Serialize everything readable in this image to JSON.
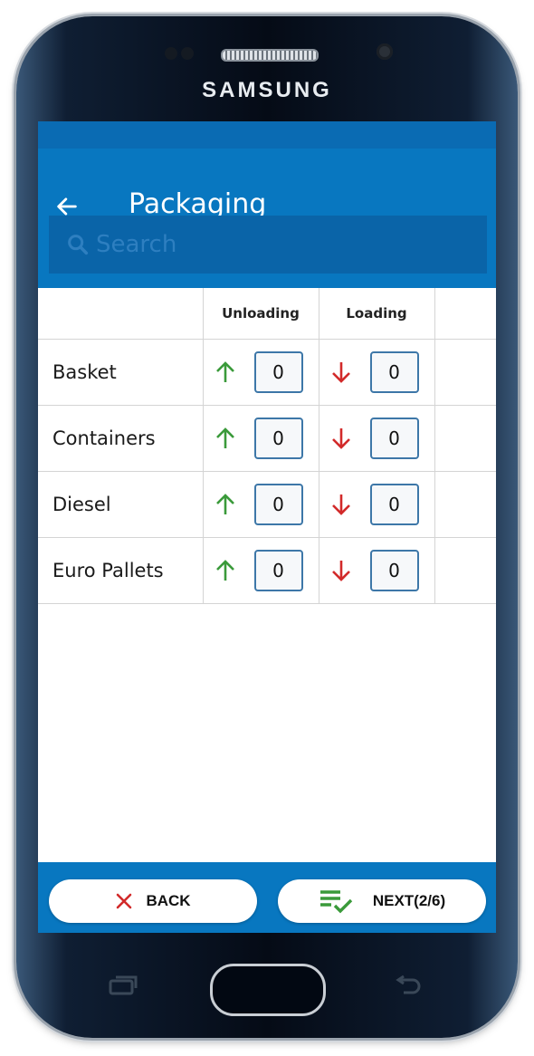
{
  "device": {
    "brand": "SAMSUNG"
  },
  "appbar": {
    "title": "Packaging",
    "back_icon": "arrow-left-icon"
  },
  "search": {
    "placeholder": "Search",
    "value": "",
    "icon": "search-icon"
  },
  "table": {
    "headers": [
      "",
      "Unloading",
      "Loading",
      ""
    ],
    "rows": [
      {
        "name": "Basket",
        "unloading": "0",
        "loading": "0"
      },
      {
        "name": "Containers",
        "unloading": "0",
        "loading": "0"
      },
      {
        "name": "Diesel",
        "unloading": "0",
        "loading": "0"
      },
      {
        "name": "Euro Pallets",
        "unloading": "0",
        "loading": "0"
      }
    ],
    "unloading_icon": "arrow-up-icon",
    "loading_icon": "arrow-down-icon"
  },
  "footer": {
    "back_label": "BACK",
    "next_label": "NEXT(2/6)"
  },
  "colors": {
    "primary": "#0877c0",
    "unloading_arrow": "#3a9a3a",
    "loading_arrow": "#d22a2a",
    "back_x": "#d22a2a",
    "next_icon": "#3a9a3a"
  }
}
